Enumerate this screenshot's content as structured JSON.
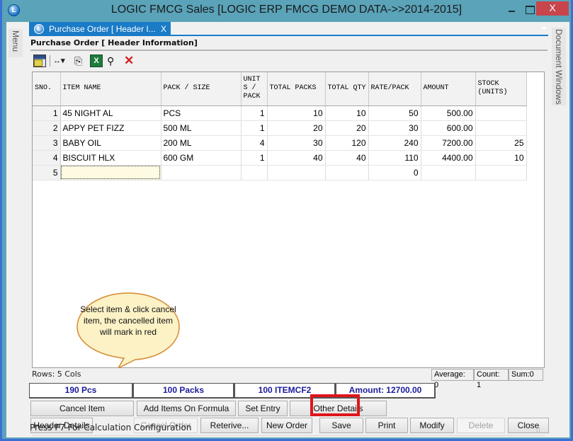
{
  "window": {
    "title": "LOGIC FMCG Sales  [LOGIC ERP FMCG DEMO DATA->>2014-2015]",
    "app_icon_glyph": "L",
    "minimize_icon": "minimize-icon",
    "maximize_icon": "maximize-icon",
    "close_glyph": "X"
  },
  "side_panels": {
    "left_label": "Menu",
    "right_label": "Document Windows"
  },
  "doc_tab": {
    "label": "Purchase Order [ Header I...",
    "close_glyph": "X"
  },
  "panel": {
    "title": "Purchase Order [ Header Information]"
  },
  "toolbar": {
    "icons": [
      "grid-settings-icon",
      "column-width-icon",
      "copy-icon",
      "excel-export-icon",
      "find-icon",
      "delete-icon"
    ],
    "cols_glyph": "↔▾",
    "copy_glyph": "⎘",
    "excel_glyph": "X",
    "find_glyph": "⚲",
    "delete_glyph": "✕"
  },
  "grid": {
    "columns": [
      "SNO.",
      "ITEM NAME",
      "PACK / SIZE",
      "UNIT S / PACK",
      "TOTAL PACKS",
      "TOTAL QTY",
      "RATE/PACK",
      "AMOUNT",
      "STOCK (UNITS)"
    ],
    "rows": [
      {
        "sno": "1",
        "item": "45 NIGHT AL",
        "pack": "PCS",
        "units": "1",
        "packs": "10",
        "qty": "10",
        "rate": "50",
        "amount": "500.00",
        "stock": ""
      },
      {
        "sno": "2",
        "item": "APPY PET FIZZ",
        "pack": "500 ML",
        "units": "1",
        "packs": "20",
        "qty": "20",
        "rate": "30",
        "amount": "600.00",
        "stock": ""
      },
      {
        "sno": "3",
        "item": "BABY OIL",
        "pack": "200 ML",
        "units": "4",
        "packs": "30",
        "qty": "120",
        "rate": "240",
        "amount": "7200.00",
        "stock": "25"
      },
      {
        "sno": "4",
        "item": "BISCUIT HLX",
        "pack": "600 GM",
        "units": "1",
        "packs": "40",
        "qty": "40",
        "rate": "110",
        "amount": "4400.00",
        "stock": "10"
      },
      {
        "sno": "5",
        "item": "",
        "pack": "",
        "units": "",
        "packs": "",
        "qty": "",
        "rate": "0",
        "amount": "",
        "stock": ""
      }
    ]
  },
  "grid_footer": {
    "rows_info": "Rows: 5  Cols",
    "average": "Average: 0",
    "count": "Count: 1",
    "sum": "Sum:0"
  },
  "totals": {
    "pcs": "190 Pcs",
    "packs": "100 Packs",
    "itemcf": "100 ITEMCF2",
    "amount": "Amount: 12700.00"
  },
  "buttons": {
    "cancel_item": "Cancel Item",
    "add_items_formula": "Add Items On Formula",
    "set_entry": "Set Entry",
    "other_details": "Other Details",
    "header_details": "Header Details",
    "cancel_order": "Cancel Order",
    "retrieve": "Reterive...",
    "new_order": "New Order",
    "save": "Save",
    "print": "Print",
    "modify": "Modify",
    "delete": "Delete",
    "close": "Close"
  },
  "callout": {
    "text": "Select item & click cancel item, the cancelled item will mark in red"
  },
  "status": {
    "text": "Press F7 For Calculation Configuration"
  }
}
